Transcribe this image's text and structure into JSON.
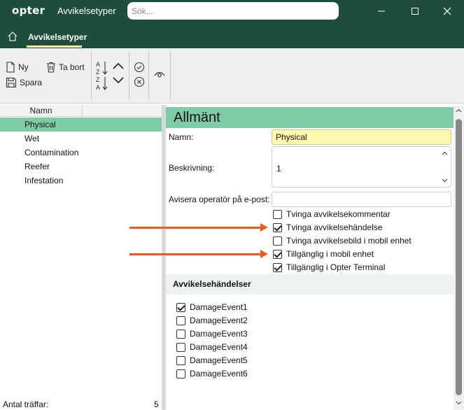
{
  "titlebar": {
    "logo": "opter",
    "app_title": "Avvikelsetyper",
    "search_placeholder": "Sök..."
  },
  "nav": {
    "active_tab": "Avvikelsetyper"
  },
  "ribbon": {
    "new_label": "Ny",
    "delete_label": "Ta bort",
    "save_label": "Spara"
  },
  "list": {
    "column_header": "Namn",
    "items": [
      "Physical",
      "Wet",
      "Contamination",
      "Reefer",
      "Infestation"
    ],
    "selected": "Physical",
    "footer_label": "Antal träffar:",
    "footer_count": "5"
  },
  "details": {
    "section_title": "Allmänt",
    "name_label": "Namn:",
    "name_value": "Physical",
    "description_label": "Beskrivning:",
    "description_value": "1",
    "email_label": "Avisera operatör på e-post:",
    "email_value": "",
    "checkboxes": [
      {
        "label": "Tvinga avvikelsekommentar",
        "checked": false
      },
      {
        "label": "Tvinga avvikelsehändelse",
        "checked": true
      },
      {
        "label": "Tvinga avvikelsebild i mobil enhet",
        "checked": false
      },
      {
        "label": "Tillgänglig i mobil enhet",
        "checked": true
      },
      {
        "label": "Tillgänglig i Opter Terminal",
        "checked": true
      }
    ],
    "events_title": "Avvikelsehändelser",
    "events": [
      {
        "label": "DamageEvent1",
        "checked": true
      },
      {
        "label": "DamageEvent2",
        "checked": false
      },
      {
        "label": "DamageEvent3",
        "checked": false
      },
      {
        "label": "DamageEvent4",
        "checked": false
      },
      {
        "label": "DamageEvent5",
        "checked": false
      },
      {
        "label": "DamageEvent6",
        "checked": false
      }
    ]
  },
  "colors": {
    "header_dark": "#1e4d3f",
    "accent_green": "#7ecba6",
    "name_field_bg": "#fff9b0",
    "annotation_arrow": "#f05a1e"
  }
}
